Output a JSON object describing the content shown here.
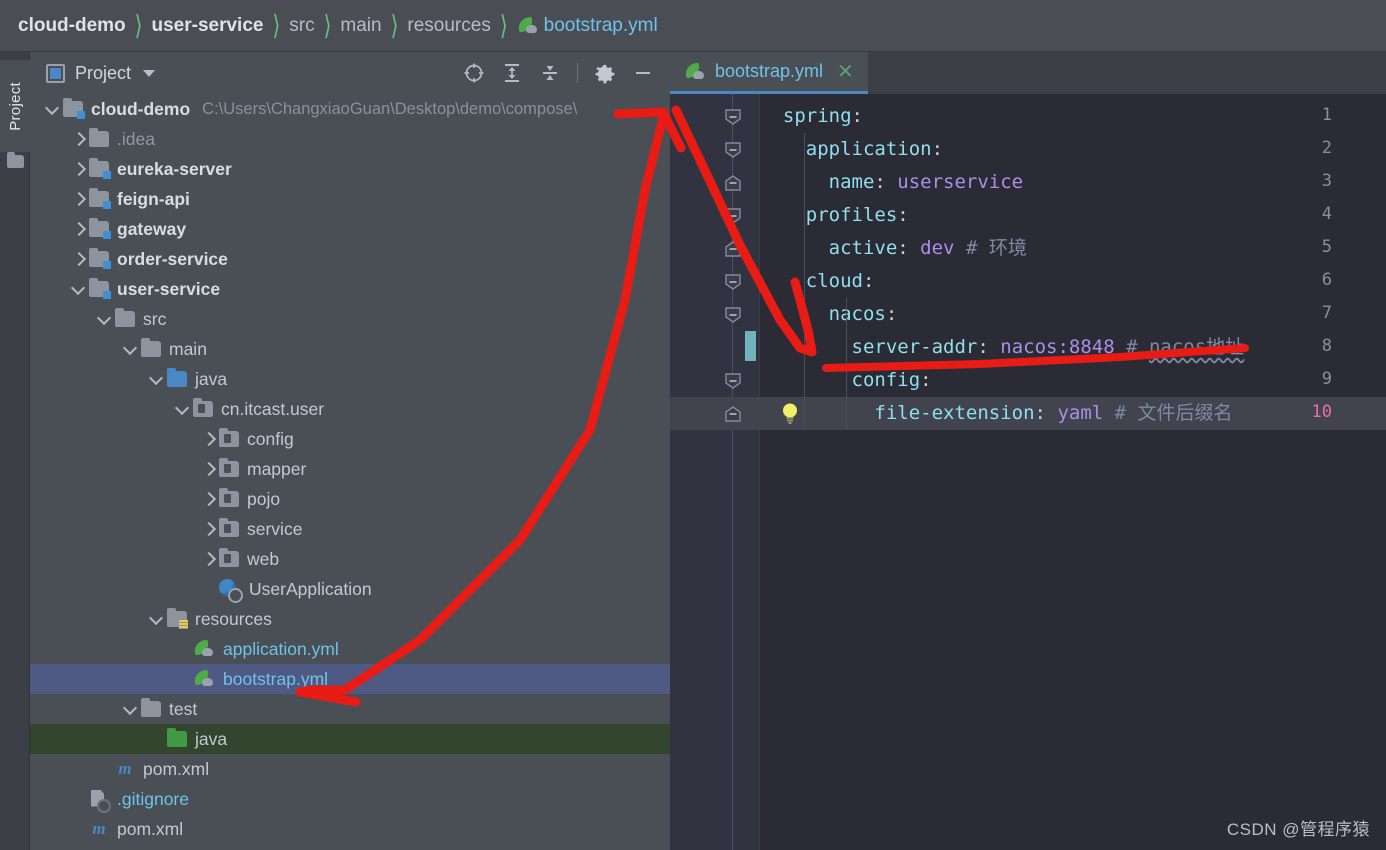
{
  "breadcrumb": {
    "items": [
      {
        "label": "cloud-demo",
        "style": "bold"
      },
      {
        "label": "user-service",
        "style": "bold"
      },
      {
        "label": "src",
        "style": "dim"
      },
      {
        "label": "main",
        "style": "dim"
      },
      {
        "label": "resources",
        "style": "dim"
      },
      {
        "label": "bootstrap.yml",
        "style": "file",
        "icon": "yml-file-icon"
      }
    ],
    "separator": "〉"
  },
  "tool_window_tab": {
    "label": "Project",
    "icon": "folder-icon"
  },
  "project_panel": {
    "title": "Project",
    "title_icon": "project-view-icon",
    "dropdown_icon": "chevron-down-icon",
    "tools": [
      {
        "name": "locate-icon",
        "tooltip": "Select Opened File"
      },
      {
        "name": "expand-all-icon",
        "tooltip": "Expand All"
      },
      {
        "name": "collapse-all-icon",
        "tooltip": "Collapse All"
      },
      {
        "name": "settings-gear-icon",
        "tooltip": "Settings"
      },
      {
        "name": "hide-icon",
        "tooltip": "Hide"
      }
    ],
    "tree": [
      {
        "label": "cloud-demo",
        "path": "C:\\Users\\ChangxiaoGuan\\Desktop\\demo\\compose\\",
        "depth": 0,
        "chevron": "down",
        "icon": "module-folder-icon",
        "style": "bold"
      },
      {
        "label": ".idea",
        "depth": 1,
        "chevron": "right",
        "icon": "folder-icon",
        "style": "dim"
      },
      {
        "label": "eureka-server",
        "depth": 1,
        "chevron": "right",
        "icon": "module-folder-icon",
        "style": "bold"
      },
      {
        "label": "feign-api",
        "depth": 1,
        "chevron": "right",
        "icon": "module-folder-icon",
        "style": "bold"
      },
      {
        "label": "gateway",
        "depth": 1,
        "chevron": "right",
        "icon": "module-folder-icon",
        "style": "bold"
      },
      {
        "label": "order-service",
        "depth": 1,
        "chevron": "right",
        "icon": "module-folder-icon",
        "style": "bold"
      },
      {
        "label": "user-service",
        "depth": 1,
        "chevron": "down",
        "icon": "module-folder-icon",
        "style": "bold"
      },
      {
        "label": "src",
        "depth": 2,
        "chevron": "down",
        "icon": "folder-icon",
        "style": "plain"
      },
      {
        "label": "main",
        "depth": 3,
        "chevron": "down",
        "icon": "folder-icon",
        "style": "plain"
      },
      {
        "label": "java",
        "depth": 4,
        "chevron": "down",
        "icon": "source-folder-icon",
        "style": "plain"
      },
      {
        "label": "cn.itcast.user",
        "depth": 5,
        "chevron": "down",
        "icon": "package-icon",
        "style": "plain"
      },
      {
        "label": "config",
        "depth": 6,
        "chevron": "right",
        "icon": "package-icon",
        "style": "plain"
      },
      {
        "label": "mapper",
        "depth": 6,
        "chevron": "right",
        "icon": "package-icon",
        "style": "plain"
      },
      {
        "label": "pojo",
        "depth": 6,
        "chevron": "right",
        "icon": "package-icon",
        "style": "plain"
      },
      {
        "label": "service",
        "depth": 6,
        "chevron": "right",
        "icon": "package-icon",
        "style": "plain"
      },
      {
        "label": "web",
        "depth": 6,
        "chevron": "right",
        "icon": "package-icon",
        "style": "plain"
      },
      {
        "label": "UserApplication",
        "depth": 6,
        "chevron": "none",
        "icon": "spring-boot-class-icon",
        "style": "plain"
      },
      {
        "label": "resources",
        "depth": 4,
        "chevron": "down",
        "icon": "resources-folder-icon",
        "style": "plain"
      },
      {
        "label": "application.yml",
        "depth": 5,
        "chevron": "none",
        "icon": "yml-file-icon",
        "style": "file"
      },
      {
        "label": "bootstrap.yml",
        "depth": 5,
        "chevron": "none",
        "icon": "yml-file-icon",
        "style": "file",
        "selected": true
      },
      {
        "label": "test",
        "depth": 3,
        "chevron": "down",
        "icon": "folder-icon",
        "style": "plain"
      },
      {
        "label": "java",
        "depth": 4,
        "chevron": "none",
        "icon": "test-source-folder-icon",
        "style": "plain",
        "test_source": true
      },
      {
        "label": "pom.xml",
        "depth": 2,
        "chevron": "none",
        "icon": "maven-icon",
        "style": "plain"
      },
      {
        "label": ".gitignore",
        "depth": 1,
        "chevron": "none",
        "icon": "gitignore-icon",
        "style": "file"
      },
      {
        "label": "pom.xml",
        "depth": 1,
        "chevron": "none",
        "icon": "maven-icon",
        "style": "plain"
      }
    ]
  },
  "editor": {
    "tab": {
      "label": "bootstrap.yml",
      "icon": "yml-file-icon",
      "close_icon": "close-icon"
    },
    "current_line": 10,
    "vcs_change_line": 8,
    "intention_bulb_line": 10,
    "lines": [
      {
        "num": 1,
        "indent": 0,
        "fold": "expanded",
        "tokens": [
          {
            "t": "spring",
            "c": "k"
          },
          {
            "t": ":",
            "c": "p"
          }
        ]
      },
      {
        "num": 2,
        "indent": 1,
        "fold": "expanded",
        "tokens": [
          {
            "t": "application",
            "c": "k"
          },
          {
            "t": ":",
            "c": "p"
          }
        ]
      },
      {
        "num": 3,
        "indent": 2,
        "fold": "leaf",
        "tokens": [
          {
            "t": "name",
            "c": "k"
          },
          {
            "t": ": ",
            "c": "p"
          },
          {
            "t": "userservice",
            "c": "v"
          }
        ]
      },
      {
        "num": 4,
        "indent": 1,
        "fold": "expanded",
        "tokens": [
          {
            "t": "profiles",
            "c": "k"
          },
          {
            "t": ":",
            "c": "p"
          }
        ]
      },
      {
        "num": 5,
        "indent": 2,
        "fold": "leaf",
        "tokens": [
          {
            "t": "active",
            "c": "k"
          },
          {
            "t": ": ",
            "c": "p"
          },
          {
            "t": "dev",
            "c": "v"
          },
          {
            "t": " ",
            "c": "p"
          },
          {
            "t": "# 环境",
            "c": "cm"
          }
        ]
      },
      {
        "num": 6,
        "indent": 1,
        "fold": "expanded",
        "tokens": [
          {
            "t": "cloud",
            "c": "k"
          },
          {
            "t": ":",
            "c": "p"
          }
        ]
      },
      {
        "num": 7,
        "indent": 2,
        "fold": "expanded",
        "tokens": [
          {
            "t": "nacos",
            "c": "k"
          },
          {
            "t": ":",
            "c": "p"
          }
        ]
      },
      {
        "num": 8,
        "indent": 3,
        "fold": "none",
        "tokens": [
          {
            "t": "server-addr",
            "c": "k"
          },
          {
            "t": ": ",
            "c": "p"
          },
          {
            "t": "nacos:8848",
            "c": "v"
          },
          {
            "t": " ",
            "c": "p"
          },
          {
            "t": "# ",
            "c": "cm"
          },
          {
            "t": "nacos地址",
            "c": "cm-wave"
          }
        ]
      },
      {
        "num": 9,
        "indent": 3,
        "fold": "expanded",
        "tokens": [
          {
            "t": "config",
            "c": "k"
          },
          {
            "t": ":",
            "c": "p"
          }
        ]
      },
      {
        "num": 10,
        "indent": 4,
        "fold": "leaf",
        "tokens": [
          {
            "t": "file-extension",
            "c": "k"
          },
          {
            "t": ": ",
            "c": "p"
          },
          {
            "t": "yaml",
            "c": "v"
          },
          {
            "t": " ",
            "c": "p"
          },
          {
            "t": "# 文件后缀名",
            "c": "cm"
          }
        ]
      }
    ]
  },
  "annotation": {
    "color": "#e81c14",
    "description": "red hand-drawn arrow from bootstrap.yml in tree to server-addr line, plus underline under nacos address comment"
  },
  "watermark": {
    "text": "CSDN @管程序猿"
  },
  "colors": {
    "accent_blue": "#4a87c7",
    "file_cyan": "#6fc2e8",
    "selection_blue": "#4f5a84",
    "test_source_green": "#33452f",
    "yaml_key": "#8fdfef",
    "yaml_value": "#a98fe8",
    "comment": "#7e8aa3",
    "annotation_red": "#e81c14",
    "editor_bg": "#2b2b35",
    "panel_bg": "#4a4e55"
  }
}
